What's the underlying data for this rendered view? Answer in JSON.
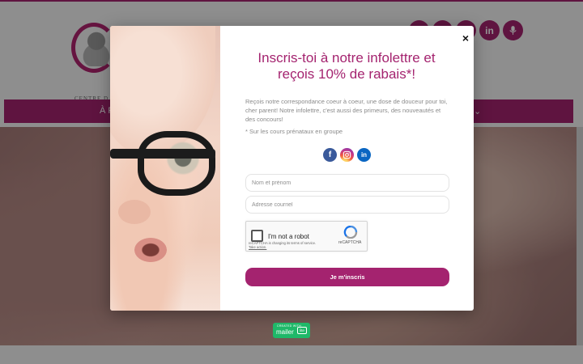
{
  "background": {
    "logo_text": "CENTRE D",
    "nav_items": [
      "À P",
      "⌄"
    ],
    "social_icons": [
      "facebook-icon",
      "instagram-icon",
      "pinterest-icon",
      "linkedin-icon",
      "podcast-icon"
    ],
    "social_labels": [
      "",
      "",
      "",
      "in",
      ""
    ]
  },
  "popup": {
    "close_label": "×",
    "title": "Inscris-toi à notre infolettre et reçois 10% de rabais*!",
    "description": "Reçois notre correspondance coeur à coeur, une dose de douceur pour toi, cher parent! Notre infolettre, c'est aussi des primeurs, des nouveautés et des concours!",
    "note": "* Sur les cours prénataux en groupe",
    "social_icons": [
      "facebook-icon",
      "instagram-icon",
      "linkedin-icon"
    ],
    "social_labels": [
      "f",
      "",
      "in"
    ],
    "fields": {
      "name_placeholder": "Nom et prénom",
      "email_placeholder": "Adresse courriel"
    },
    "captcha": {
      "label": "I'm not a robot",
      "brand": "reCAPTCHA",
      "notice": "reCAPTCHA is changing its terms of service.",
      "notice_link": "Take action."
    },
    "submit_label": "Je m'inscris"
  },
  "badge": {
    "small_text": "CREATED WITH",
    "word": "mailer",
    "suffix": "lite"
  },
  "colors": {
    "brand": "#a4236f",
    "facebook": "#3a5a9b",
    "linkedin": "#0a66c2",
    "mailerlite": "#1fb869"
  }
}
